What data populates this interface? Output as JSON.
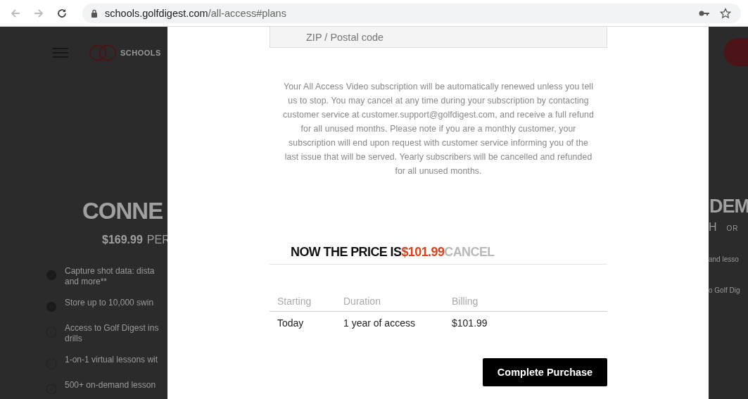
{
  "browser": {
    "url_host": "schools.golfdigest.com",
    "url_path": "/all-access#plans"
  },
  "background_page": {
    "logo_text": "SCHOOLS",
    "left": {
      "headline": "CONNE",
      "price": "$169.99",
      "price_unit": "PER",
      "features": [
        {
          "kind": "filled",
          "lines": [
            "Capture shot data: dista",
            "and more**"
          ]
        },
        {
          "kind": "filled",
          "lines": [
            "Store up to 10,000 swin"
          ]
        },
        {
          "kind": "outline",
          "lines": [
            "Access to Golf Digest ins",
            "drills"
          ]
        },
        {
          "kind": "outline",
          "lines": [
            "1-on-1 virtual lessons wit"
          ]
        },
        {
          "kind": "outline",
          "lines": [
            "500+ on-demand lesson"
          ]
        }
      ]
    },
    "right": {
      "headline": "DEM",
      "price_tail": "H",
      "or": "OR",
      "features": [
        "and lesso",
        "o Golf Dig"
      ]
    }
  },
  "modal": {
    "zip_field": {
      "placeholder": "ZIP / Postal code"
    },
    "notice": "Your All Access Video subscription will be automatically renewed unless you tell us to stop. You may cancel at any time during your subscription by contacting customer service at customer.support@golfdigest.com, and receive a full refund for all unused months. Please note if you are a monthly customer, your subscription will end upon request with customer service informing you of the last issue that will be served. Yearly subscribers will be cancelled and refunded for all unused months.",
    "price_line": {
      "label": "NOW THE PRICE IS",
      "price": "$101.99",
      "cancel": "CANCEL"
    },
    "table": {
      "columns": [
        "Starting",
        "Duration",
        "Billing"
      ],
      "rows": [
        [
          "Today",
          "1 year of access",
          "$101.99"
        ]
      ]
    },
    "button": "Complete Purchase"
  }
}
